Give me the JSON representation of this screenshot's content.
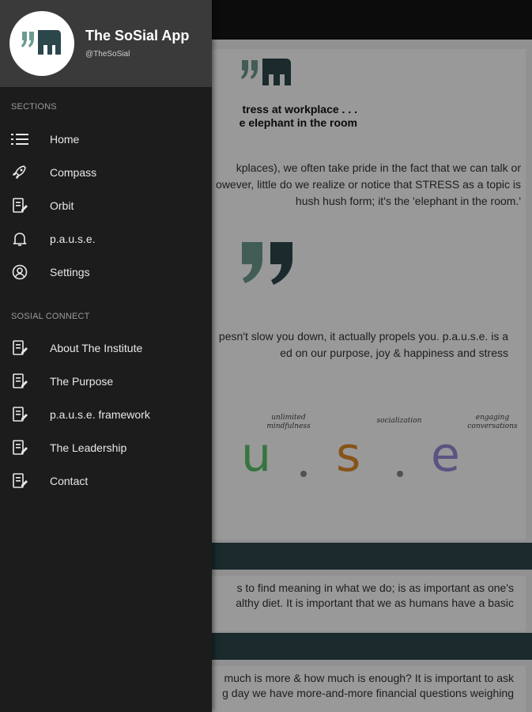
{
  "app": {
    "title": "The SoSial App",
    "handle": "@TheSoSial"
  },
  "drawer": {
    "sections_label": "SECTIONS",
    "sections": [
      {
        "label": "Home",
        "icon": "list-icon"
      },
      {
        "label": "Compass",
        "icon": "rocket-icon"
      },
      {
        "label": "Orbit",
        "icon": "edit-note-icon"
      },
      {
        "label": "p.a.u.s.e.",
        "icon": "bell-icon"
      },
      {
        "label": "Settings",
        "icon": "user-circle-icon"
      }
    ],
    "connect_label": "SOSIAL CONNECT",
    "connect": [
      {
        "label": "About The Institute",
        "icon": "edit-note-icon"
      },
      {
        "label": "The Purpose",
        "icon": "edit-note-icon"
      },
      {
        "label": "p.a.u.s.e. framework",
        "icon": "edit-note-icon"
      },
      {
        "label": "The Leadership",
        "icon": "edit-note-icon"
      },
      {
        "label": "Contact",
        "icon": "edit-note-icon"
      }
    ]
  },
  "page": {
    "title_line1": "tress at workplace . . .",
    "title_line2": "e elephant in the room",
    "para1": "kplaces), we often take pride in the fact that we can talk or\nowever, little do we realize or notice that STRESS as a topic is\nhush hush form; it's the 'elephant in the room.'",
    "para2": "pesn't slow you down, it actually propels you. p.a.u.s.e. is a\ned on our purpose, joy & happiness and stress",
    "pause_tags": [
      "unlimited\nmindfulness",
      "socialization",
      "engaging\nconversations"
    ],
    "pause_letters": [
      "u",
      "s",
      "e"
    ],
    "panel1": "s to find meaning in what we do; is as important as one's\nalthy diet. It is important that we as humans have a basic",
    "panel2": "much is more & how much is enough? It is important to ask\ng day we have more-and-more financial questions weighing"
  },
  "colors": {
    "drawer_bg": "#1c1c1c",
    "header_bg": "#3a3a3a",
    "teal": "#2c474c",
    "quote_light": "#6e9a90",
    "letter_u": "#5cc26a",
    "letter_s": "#e08a2a",
    "letter_e": "#9a8ad8"
  }
}
